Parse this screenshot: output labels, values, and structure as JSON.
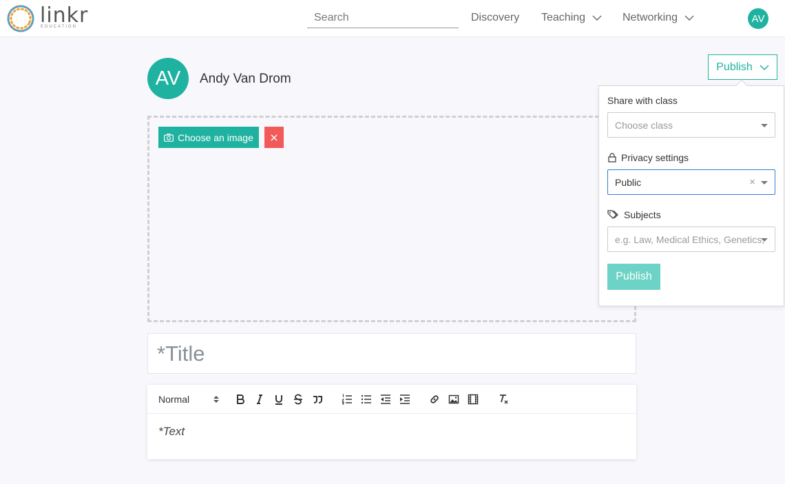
{
  "brand": {
    "name": "linkr",
    "tagline": "EDUCATION"
  },
  "colors": {
    "accent": "#20b2a0",
    "danger": "#f25a5a",
    "focus": "#2a7fd4",
    "publish_disabled": "#6dd3c6"
  },
  "nav": {
    "search_placeholder": "Search",
    "links": [
      {
        "label": "Discovery",
        "has_dropdown": false
      },
      {
        "label": "Teaching",
        "has_dropdown": true
      },
      {
        "label": "Networking",
        "has_dropdown": true
      }
    ],
    "user_initials": "AV"
  },
  "author": {
    "initials": "AV",
    "name": "Andy Van Drom"
  },
  "publish_toggle_label": "Publish",
  "image_upload": {
    "choose_label": "Choose an image",
    "icons": [
      "camera-icon",
      "close-icon"
    ]
  },
  "title_placeholder": "*Title",
  "editor": {
    "format_select": "Normal",
    "toolbar_icons": [
      "bold-icon",
      "italic-icon",
      "underline-icon",
      "strikethrough-icon",
      "blockquote-icon",
      "ordered-list-icon",
      "bullet-list-icon",
      "outdent-icon",
      "indent-icon",
      "link-icon",
      "image-icon",
      "video-icon",
      "clear-format-icon"
    ],
    "body_placeholder": "*Text"
  },
  "publish_panel": {
    "share_label": "Share with class",
    "class_placeholder": "Choose class",
    "privacy_label": "Privacy settings",
    "privacy_value": "Public",
    "subjects_label": "Subjects",
    "subjects_placeholder": "e.g. Law, Medical Ethics, Genetics, ...",
    "publish_button": "Publish"
  }
}
